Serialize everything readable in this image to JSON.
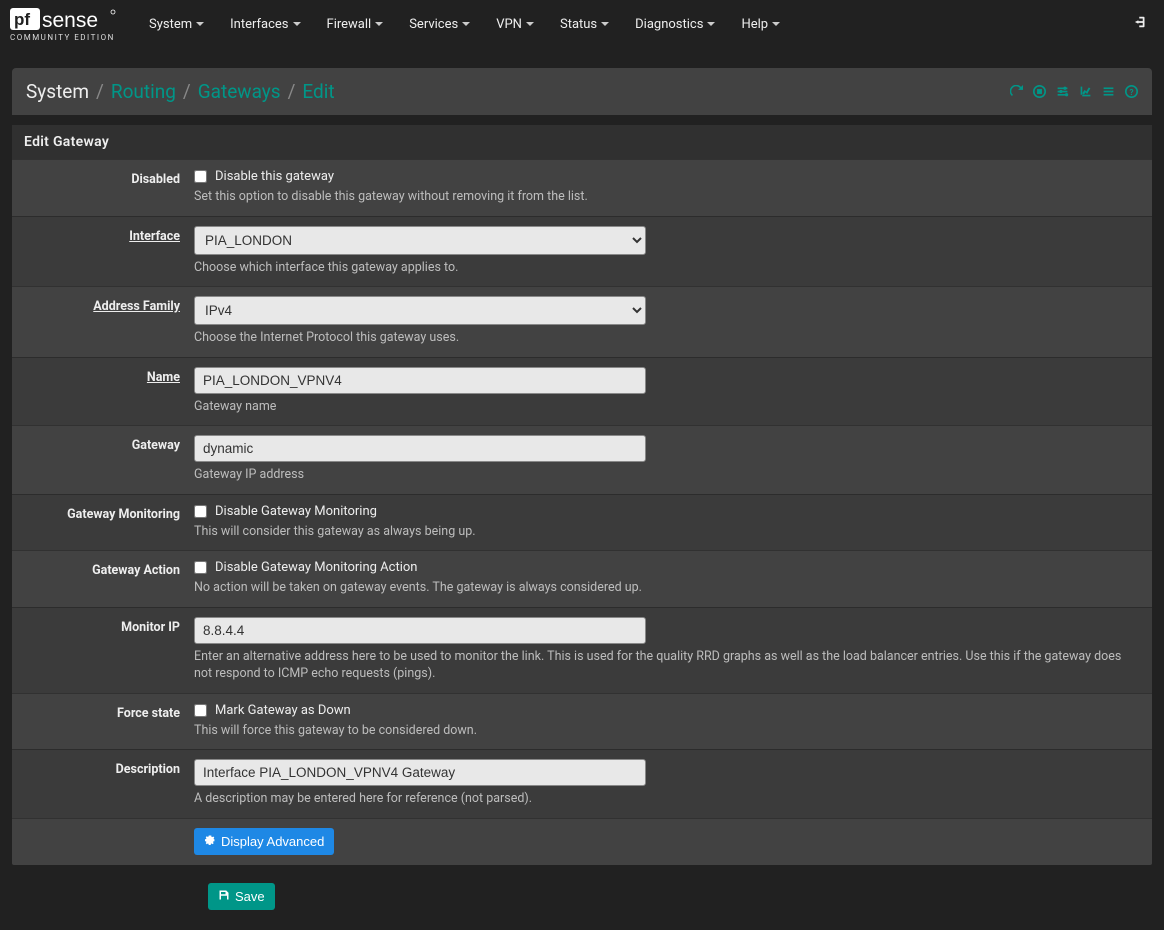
{
  "logo": {
    "sub": "COMMUNITY EDITION"
  },
  "nav": {
    "items": [
      "System",
      "Interfaces",
      "Firewall",
      "Services",
      "VPN",
      "Status",
      "Diagnostics",
      "Help"
    ]
  },
  "breadcrumb": {
    "root": "System",
    "links": [
      "Routing",
      "Gateways"
    ],
    "current": "Edit"
  },
  "panel": {
    "title": "Edit Gateway"
  },
  "labels": {
    "disabled": "Disabled",
    "interface": "Interface",
    "addrfam": "Address Family",
    "name": "Name",
    "gateway": "Gateway",
    "monitoring": "Gateway Monitoring",
    "action": "Gateway Action",
    "monitorip": "Monitor IP",
    "forcestate": "Force state",
    "description": "Description"
  },
  "fields": {
    "disabled_cb": "Disable this gateway",
    "disabled_help": "Set this option to disable this gateway without removing it from the list.",
    "interface_value": "PIA_LONDON",
    "interface_help": "Choose which interface this gateway applies to.",
    "addrfam_value": "IPv4",
    "addrfam_help": "Choose the Internet Protocol this gateway uses.",
    "name_value": "PIA_LONDON_VPNV4",
    "name_help": "Gateway name",
    "gateway_value": "dynamic",
    "gateway_help": "Gateway IP address",
    "monitoring_cb": "Disable Gateway Monitoring",
    "monitoring_help": "This will consider this gateway as always being up.",
    "action_cb": "Disable Gateway Monitoring Action",
    "action_help": "No action will be taken on gateway events. The gateway is always considered up.",
    "monitorip_value": "8.8.4.4",
    "monitorip_help": "Enter an alternative address here to be used to monitor the link. This is used for the quality RRD graphs as well as the load balancer entries. Use this if the gateway does not respond to ICMP echo requests (pings).",
    "forcestate_cb": "Mark Gateway as Down",
    "forcestate_help": "This will force this gateway to be considered down.",
    "description_value": "Interface PIA_LONDON_VPNV4 Gateway",
    "description_help": "A description may be entered here for reference (not parsed)."
  },
  "buttons": {
    "advanced": "Display Advanced",
    "save": "Save"
  }
}
